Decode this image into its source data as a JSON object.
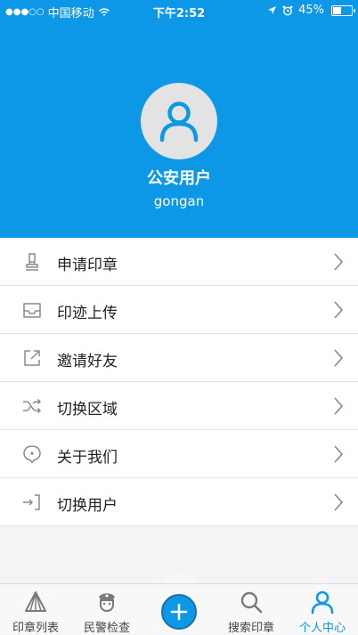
{
  "status_bar": {
    "carrier": "中国移动",
    "time": "下午2:52",
    "battery": "45%",
    "battery_level": 0.45
  },
  "profile": {
    "name": "公安用户",
    "account": "gongan",
    "avatar_icon": "user-avatar-icon"
  },
  "menu": {
    "items": [
      {
        "label": "申请印章",
        "icon": "stamp-icon"
      },
      {
        "label": "印迹上传",
        "icon": "inbox-upload-icon"
      },
      {
        "label": "邀请好友",
        "icon": "share-external-icon"
      },
      {
        "label": "切换区域",
        "icon": "shuffle-icon"
      },
      {
        "label": "关于我们",
        "icon": "chat-bubble-icon"
      },
      {
        "label": "切换用户",
        "icon": "login-switch-icon"
      }
    ]
  },
  "tabbar": {
    "tabs": [
      {
        "label": "印章列表",
        "icon": "stamp-list-icon"
      },
      {
        "label": "民警检查",
        "icon": "police-icon"
      },
      {
        "label": "搜索印章",
        "icon": "search-icon"
      },
      {
        "label": "个人中心",
        "icon": "person-icon"
      }
    ],
    "active": "个人中心",
    "center_button_icon": "plus-icon"
  },
  "colors": {
    "accent": "#0c98e6",
    "icon_gray": "#8a8a8a",
    "background": "#f4f4f6"
  }
}
